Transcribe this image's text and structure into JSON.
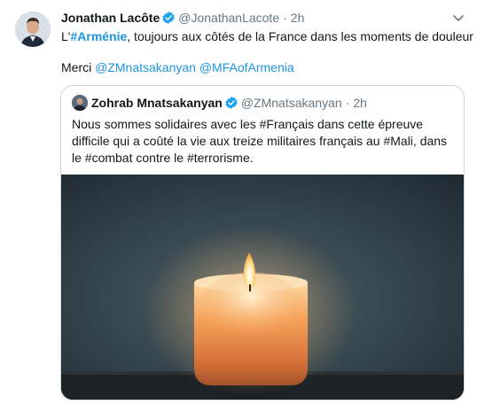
{
  "tweet": {
    "author_name": "Jonathan Lacôte",
    "author_handle": "@JonathanLacote",
    "separator": "·",
    "time": "2h",
    "line1_prefix": "L'",
    "line1_hashtag": "#Arménie",
    "line1_rest": ", toujours aux côtés de la France dans les moments de douleur",
    "line2_prefix": "Merci ",
    "mention1": "@ZMnatsakanyan",
    "mention2": "@MFAofArmenia"
  },
  "quoted_tweet": {
    "author_name": "Zohrab Mnatsakanyan",
    "author_handle": "@ZMnatsakanyan",
    "separator": "·",
    "time": "2h",
    "text": "Nous sommes solidaires avec les #Français dans cette épreuve difficile qui a coûté la vie aux treize militaires français au #Mali, dans le #combat contre le #terrorisme."
  },
  "icons": {
    "verified": "verified-badge-icon",
    "caret": "chevron-down-icon",
    "media": "candle-photo"
  },
  "colors": {
    "link": "#1b95e0",
    "verified": "#1da1f2",
    "muted": "#657786"
  }
}
